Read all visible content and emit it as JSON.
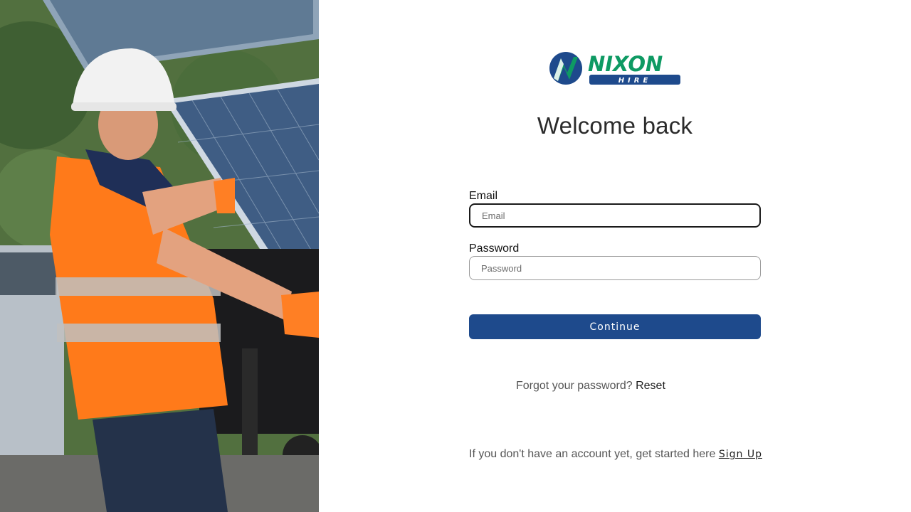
{
  "brand": {
    "name": "NIXON",
    "sub": "HIRE",
    "primary_color": "#1e4a8c",
    "green_color": "#0e9a63"
  },
  "hero": {
    "alt_icon": "worker-installing-solar-panel-image"
  },
  "form": {
    "title": "Welcome back",
    "email_label": "Email",
    "email_placeholder": "Email",
    "password_label": "Password",
    "password_placeholder": "Password",
    "continue_label": "Continue"
  },
  "footer": {
    "forgot_text": "Forgot your password?",
    "reset_label": "Reset",
    "signup_text": "If you don't have an account yet, get started here",
    "signup_label": "Sign Up"
  }
}
